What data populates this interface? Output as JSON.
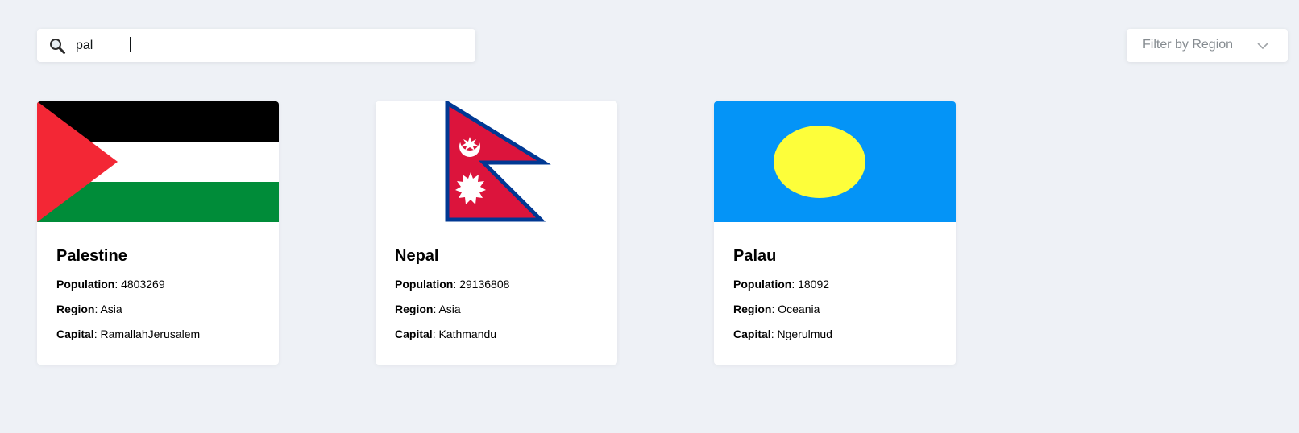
{
  "search": {
    "value": "pal",
    "icon": "search-icon"
  },
  "filter": {
    "label": "Filter by Region",
    "icon": "chevron-down-icon"
  },
  "labels": {
    "population": "Population",
    "region": "Region",
    "capital": "Capital",
    "separator": ": "
  },
  "countries": [
    {
      "name": "Palestine",
      "population": "4803269",
      "region": "Asia",
      "capital": "RamallahJerusalem",
      "flag_colors": [
        "#000000",
        "#ffffff",
        "#008c39",
        "#f32735"
      ]
    },
    {
      "name": "Nepal",
      "population": "29136808",
      "region": "Asia",
      "capital": "Kathmandu",
      "flag_colors": [
        "#dc143c",
        "#003893",
        "#ffffff"
      ]
    },
    {
      "name": "Palau",
      "population": "18092",
      "region": "Oceania",
      "capital": "Ngerulmud",
      "flag_colors": [
        "#0494f7",
        "#fdfe3a"
      ]
    }
  ]
}
